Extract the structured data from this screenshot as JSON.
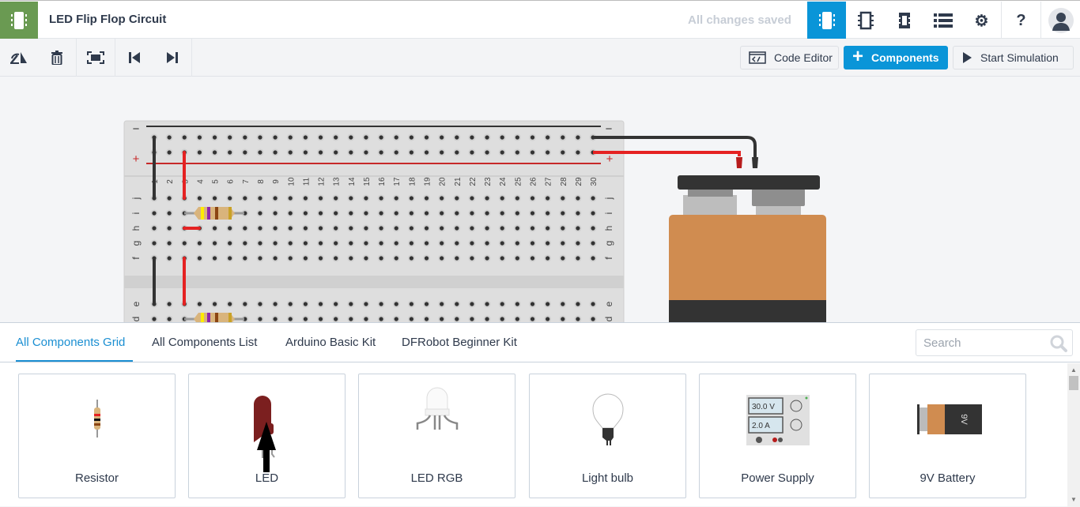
{
  "header": {
    "title": "LED Flip Flop Circuit",
    "status": "All changes saved",
    "icons": [
      "circuit-view-icon",
      "schematic-view-icon",
      "component-list-icon",
      "list-icon",
      "settings-icon",
      "help-icon",
      "avatar-icon"
    ],
    "help_label": "?"
  },
  "toolbar": {
    "icons": [
      "rotate-icon",
      "delete-icon",
      "fit-view-icon",
      "step-back-icon",
      "step-forward-icon"
    ],
    "code_editor": "Code Editor",
    "components": "Components",
    "start_simulation": "Start Simulation"
  },
  "breadboard": {
    "columns": [
      "1",
      "2",
      "3",
      "4",
      "5",
      "6",
      "7",
      "8",
      "9",
      "10",
      "11",
      "12",
      "13",
      "14",
      "15",
      "16",
      "17",
      "18",
      "19",
      "20",
      "21",
      "22",
      "23",
      "24",
      "25",
      "26",
      "27",
      "28",
      "29",
      "30"
    ],
    "rows_top": [
      "j",
      "i",
      "h",
      "g",
      "f"
    ],
    "rows_bottom": [
      "e",
      "d"
    ],
    "rail_minus": "−",
    "rail_plus": "+"
  },
  "panel": {
    "tabs": [
      {
        "label": "All Components Grid",
        "active": true
      },
      {
        "label": "All Components List"
      },
      {
        "label": "Arduino Basic Kit"
      },
      {
        "label": "DFRobot Beginner Kit"
      }
    ],
    "search_placeholder": "Search",
    "components": [
      {
        "label": "Resistor"
      },
      {
        "label": "LED"
      },
      {
        "label": "LED RGB"
      },
      {
        "label": "Light bulb"
      },
      {
        "label": "Power Supply",
        "voltage": "30.0 V",
        "current": "2.0 A"
      },
      {
        "label": "9V Battery",
        "battery_text": "9V"
      }
    ]
  },
  "colors": {
    "brand": "#6a9a52",
    "accent": "#0a95d8",
    "wire_red": "#e52222",
    "wire_black": "#333333",
    "battery": "#d08c50"
  }
}
